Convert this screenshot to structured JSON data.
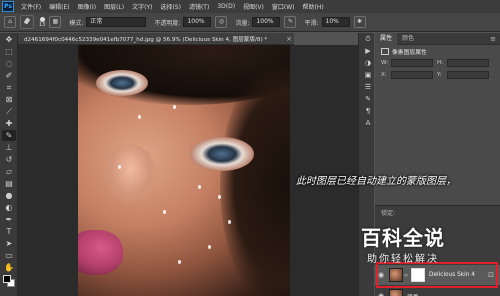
{
  "menubar": {
    "logo": "Ps",
    "items": [
      "文件(F)",
      "编辑(E)",
      "图像(I)",
      "图层(L)",
      "文字(Y)",
      "选择(S)",
      "滤镜(T)",
      "3D(D)",
      "视图(V)",
      "窗口(W)",
      "帮助(H)"
    ]
  },
  "options": {
    "brush_size": "13",
    "mode_label": "模式:",
    "mode_value": "正常",
    "opacity_label": "不透明度:",
    "opacity_value": "100%",
    "flow_label": "流量:",
    "flow_value": "100%",
    "smooth_label": "平滑:",
    "smooth_value": "10%"
  },
  "document": {
    "tab_title": "d2461694f0c0446c52339e041efb7077_hd.jpg @ 56.9% (Delicious Skin 4, 图层蒙版/8) *",
    "close_glyph": "×"
  },
  "panel": {
    "tabs": [
      "属性",
      "颜色"
    ],
    "properties_title": "像素图层属性",
    "fields": [
      {
        "label": "W:",
        "label2": "H:"
      },
      {
        "label": "X:",
        "label2": "Y:"
      }
    ]
  },
  "layers": {
    "lock_label": "锁定:",
    "rows": [
      {
        "name": "Delicious Skin 4",
        "selected": true
      },
      {
        "name": "背景",
        "selected": false
      }
    ]
  },
  "annotation": "此时图层已经自动建立的蒙版图层，",
  "watermark": {
    "title": "百科全说",
    "subtitle": "助你轻松解决"
  },
  "colors": {
    "highlight_box": "#e0202a",
    "ui_dark": "#3c3c3c"
  }
}
